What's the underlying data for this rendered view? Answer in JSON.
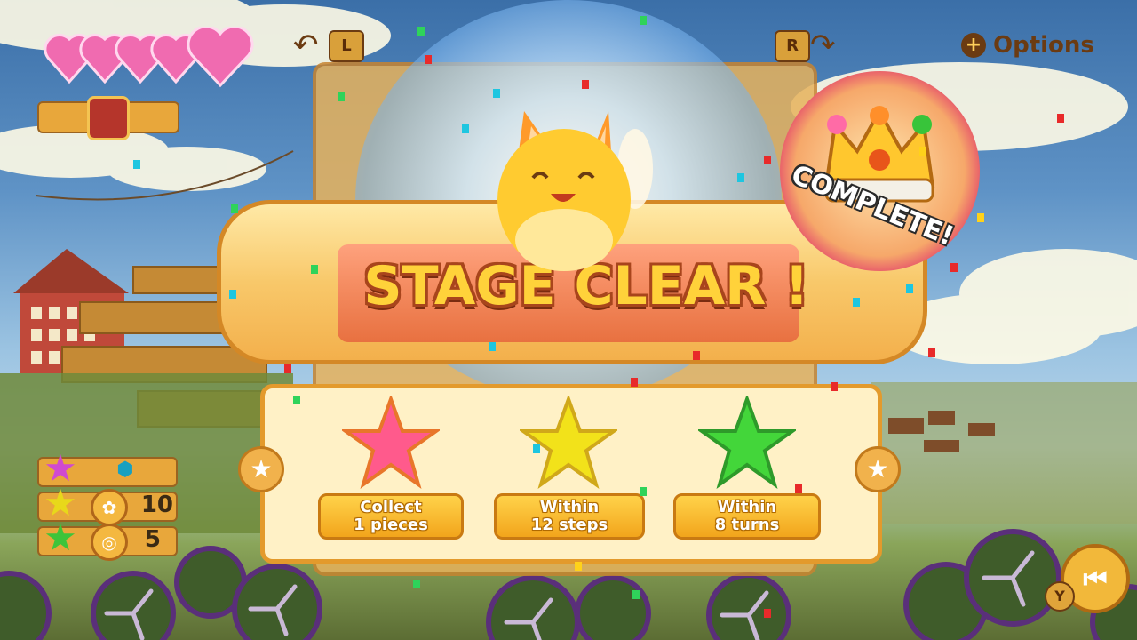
{
  "header": {
    "options_icon": "plus-circle-icon",
    "options_label": "Options",
    "left_button": "L",
    "right_button": "R",
    "lives_count": 5
  },
  "banner": {
    "title": "STAGE CLEAR !",
    "badge_text": "COMPLETE!"
  },
  "goals": [
    {
      "line1": "Collect",
      "line2": "1 pieces",
      "star_color": "#ff5a8c"
    },
    {
      "line1": "Within",
      "line2": "12 steps",
      "star_color": "#f2e21a"
    },
    {
      "line1": "Within",
      "line2": "8 turns",
      "star_color": "#43d63a"
    }
  ],
  "side_panel": {
    "rows": [
      {
        "star_color": "#d04ad0",
        "icon": "hexagon-icon",
        "value": ""
      },
      {
        "star_color": "#e8d81a",
        "icon": "paw-icon",
        "value": "10"
      },
      {
        "star_color": "#3ec43a",
        "icon": "swirl-icon",
        "value": "5"
      }
    ]
  },
  "footer": {
    "y_button": "Y",
    "rewind_icon": "skip-back-icon"
  }
}
